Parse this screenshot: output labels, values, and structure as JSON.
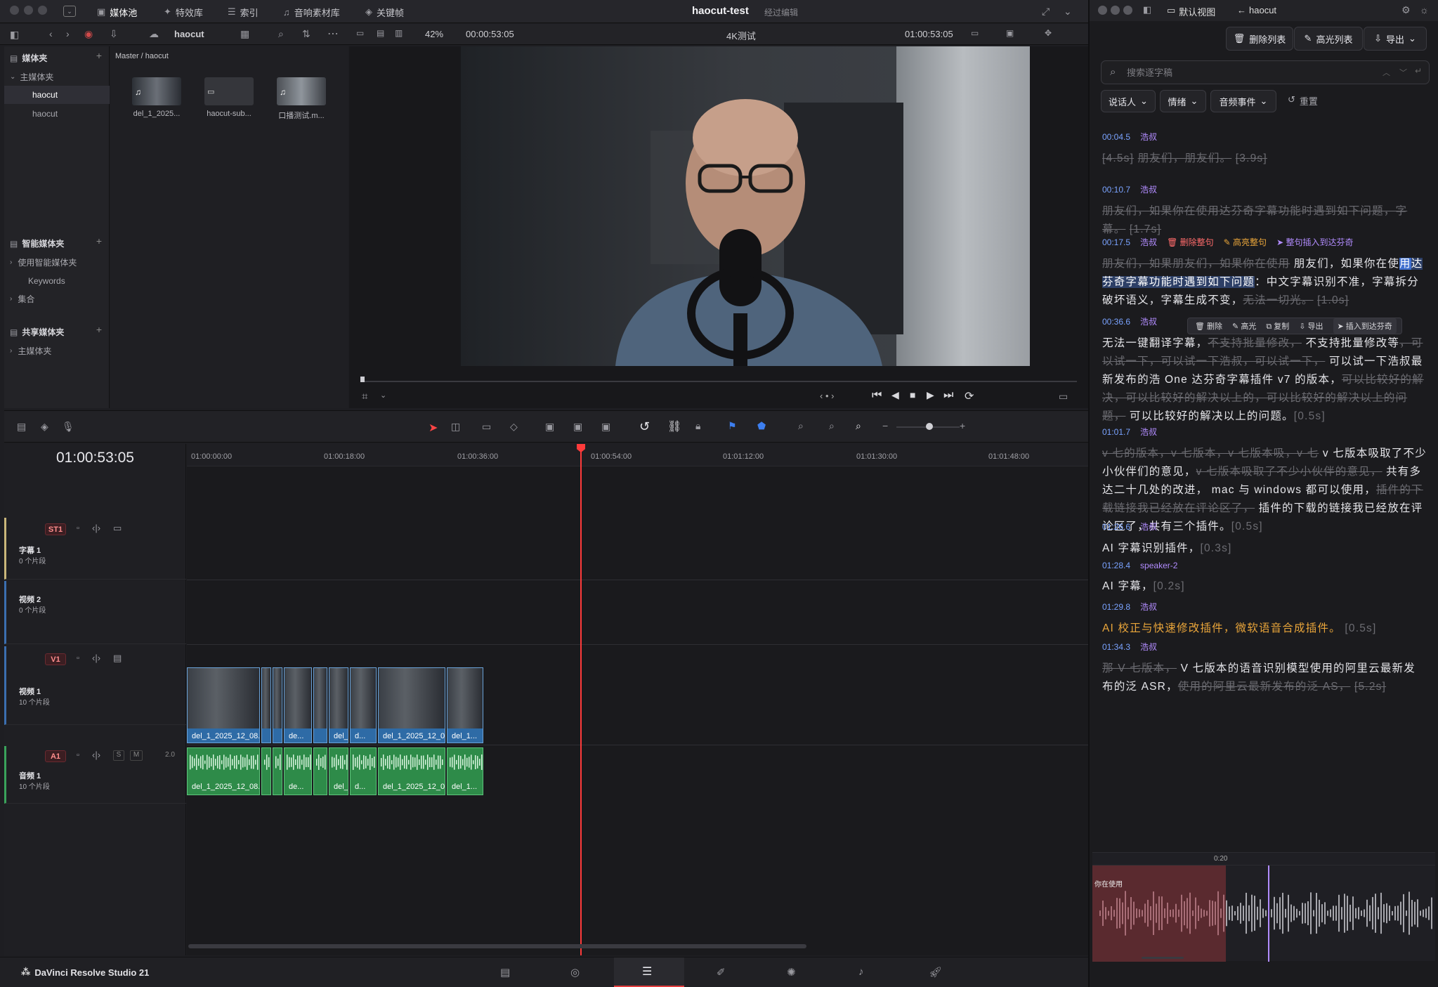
{
  "app": {
    "title": "haocut-test",
    "subtitle": "经过编辑",
    "product": "DaVinci Resolve Studio 21"
  },
  "modules": [
    "媒体池",
    "特效库",
    "索引",
    "音响素材库",
    "关键帧"
  ],
  "toolbar": {
    "bin_name": "haocut",
    "zoom": "42%",
    "timecode_left": "00:00:53:05",
    "timeline_name": "4K测试",
    "timecode_right": "01:00:53:05"
  },
  "media_side": {
    "title": "媒体夹",
    "master": "主媒体夹",
    "items": [
      "haocut",
      "haocut"
    ],
    "smart_title": "智能媒体夹",
    "smart_items": [
      "使用智能媒体夹",
      "Keywords",
      "集合"
    ],
    "shared_title": "共享媒体夹",
    "shared_items": [
      "主媒体夹"
    ]
  },
  "bin": {
    "breadcrumb": "Master / haocut",
    "clips": [
      "del_1_2025...",
      "haocut-sub...",
      "口播测试.m..."
    ]
  },
  "timeline": {
    "timecode": "01:00:53:05",
    "ruler": [
      "01:00:00:00",
      "01:00:18:00",
      "01:00:36:00",
      "01:00:54:00",
      "01:01:12:00",
      "01:01:30:00",
      "01:01:48:00"
    ],
    "tracks": [
      {
        "badge": "ST1",
        "name": "字幕 1",
        "count": "0 个片段"
      },
      {
        "badge": "",
        "name": "视频 2",
        "count": "0 个片段"
      },
      {
        "badge": "V1",
        "name": "视频 1",
        "count": "10 个片段"
      },
      {
        "badge": "A1",
        "name": "音频 1",
        "count": "10 个片段",
        "level": "2.0"
      }
    ],
    "video_clips": [
      "del_1_2025_12_08....",
      "",
      "",
      "de...",
      "",
      "del_...",
      "d...",
      "del_1_2025_12_0...",
      "del_1..."
    ],
    "audio_clips": [
      "del_1_2025_12_08....",
      "",
      "",
      "de...",
      "",
      "del_...",
      "d...",
      "del_1_2025_12_0...",
      "del_1..."
    ]
  },
  "haocut": {
    "nav_view": "默认视图",
    "nav_title": "haocut",
    "btn_delete_list": "删除列表",
    "btn_highlight_list": "高光列表",
    "btn_export": "导出",
    "search_placeholder": "搜索逐字稿",
    "filters": [
      "说话人",
      "情绪",
      "音频事件",
      "重置"
    ],
    "seg_actions": [
      "删除整句",
      "高亮整句",
      "整句插入到达芬奇"
    ],
    "popover": [
      "删除",
      "高光",
      "复制",
      "导出",
      "插入到达芬奇"
    ],
    "segments": [
      {
        "time": "00:04.5",
        "speaker": "浩叔",
        "parts": [
          [
            "s",
            "[4.5s]"
          ],
          [
            "s",
            "朋友们，朋友们。"
          ],
          [
            "s",
            "[3.9s]"
          ]
        ]
      },
      {
        "time": "00:10.7",
        "speaker": "浩叔",
        "parts": [
          [
            "s",
            "朋友们，如果你在使用达芬奇字幕功能时遇到如下问题，字幕。"
          ],
          [
            "s",
            "[1.7s]"
          ]
        ]
      },
      {
        "time": "00:17.5",
        "speaker": "浩叔",
        "parts": [
          [
            "s",
            "朋友们，如果朋友们，如果你在使用"
          ],
          [
            "t",
            "朋友们，如果你在使"
          ],
          [
            "mk",
            "用"
          ],
          [
            "mk2",
            "达芬奇字幕功能时遇到如下问题"
          ],
          [
            "t",
            "：中文字幕识别不准，字幕拆分破坏语义，字幕"
          ],
          [
            "t",
            "生成不变，"
          ],
          [
            "s",
            "无法一切光。"
          ],
          [
            "s",
            "[1.0s]"
          ]
        ]
      },
      {
        "time": "00:36.6",
        "speaker": "浩叔",
        "parts": [
          [
            "t",
            "无法一键翻译字幕，"
          ],
          [
            "s",
            "不支持批量修改，"
          ],
          [
            "t",
            "不支持批量修改等"
          ],
          [
            "s",
            "，可以试一下，可以试一下浩叔，可以试一下，"
          ],
          [
            "t",
            "可以试一下浩叔最新发布的浩 One 达芬奇字幕插件 v7 的版本，"
          ],
          [
            "s",
            "可以比较好的解决，可以比较好的解决以上的，可以比较好的解决以上的问题，"
          ],
          [
            "t",
            "可以比较好的解决以上的问题。"
          ],
          [
            "d",
            "[0.5s]"
          ]
        ]
      },
      {
        "time": "01:01.7",
        "speaker": "浩叔",
        "parts": [
          [
            "s",
            "v 七的版本，v 七版本，v 七版本吸，v 七"
          ],
          [
            "t",
            "v 七版本吸取了不少小伙伴们的意见，"
          ],
          [
            "s",
            "v 七版本吸取了不少小伙伴的意见，"
          ],
          [
            "t",
            "共有多达二十几处的改进，  mac 与 windows 都可以使用，"
          ],
          [
            "s",
            "插件的下载链接我已经放在评论区了，"
          ],
          [
            "t",
            "插件的下载的链接我已经放在评论区了，共有三个插件。"
          ],
          [
            "d",
            "[0.5s]"
          ]
        ]
      },
      {
        "time": "01:26.6",
        "speaker": "浩叔",
        "parts": [
          [
            "t",
            "AI 字幕识别插件，"
          ],
          [
            "d",
            "[0.3s]"
          ]
        ]
      },
      {
        "time": "01:28.4",
        "speaker": "speaker-2",
        "parts": [
          [
            "t",
            "AI 字幕，"
          ],
          [
            "d",
            "[0.2s]"
          ]
        ]
      },
      {
        "time": "01:29.8",
        "speaker": "浩叔",
        "parts": [
          [
            "h",
            "AI 校正与快速修改插件，微软语音合成插件。"
          ],
          [
            "d",
            "[0.5s]"
          ]
        ]
      },
      {
        "time": "01:34.3",
        "speaker": "浩叔",
        "parts": [
          [
            "s",
            "那 V 七版本，"
          ],
          [
            "t",
            "V 七版本的语音识别模型使用的阿里云最新发布的泛 ASR，"
          ],
          [
            "s",
            "使用的阿里云最新发布的泛 AS，"
          ],
          [
            "s",
            "[5.2s]"
          ]
        ]
      }
    ],
    "wave": {
      "time_label": "0:20",
      "region_text": "你在使用"
    }
  }
}
